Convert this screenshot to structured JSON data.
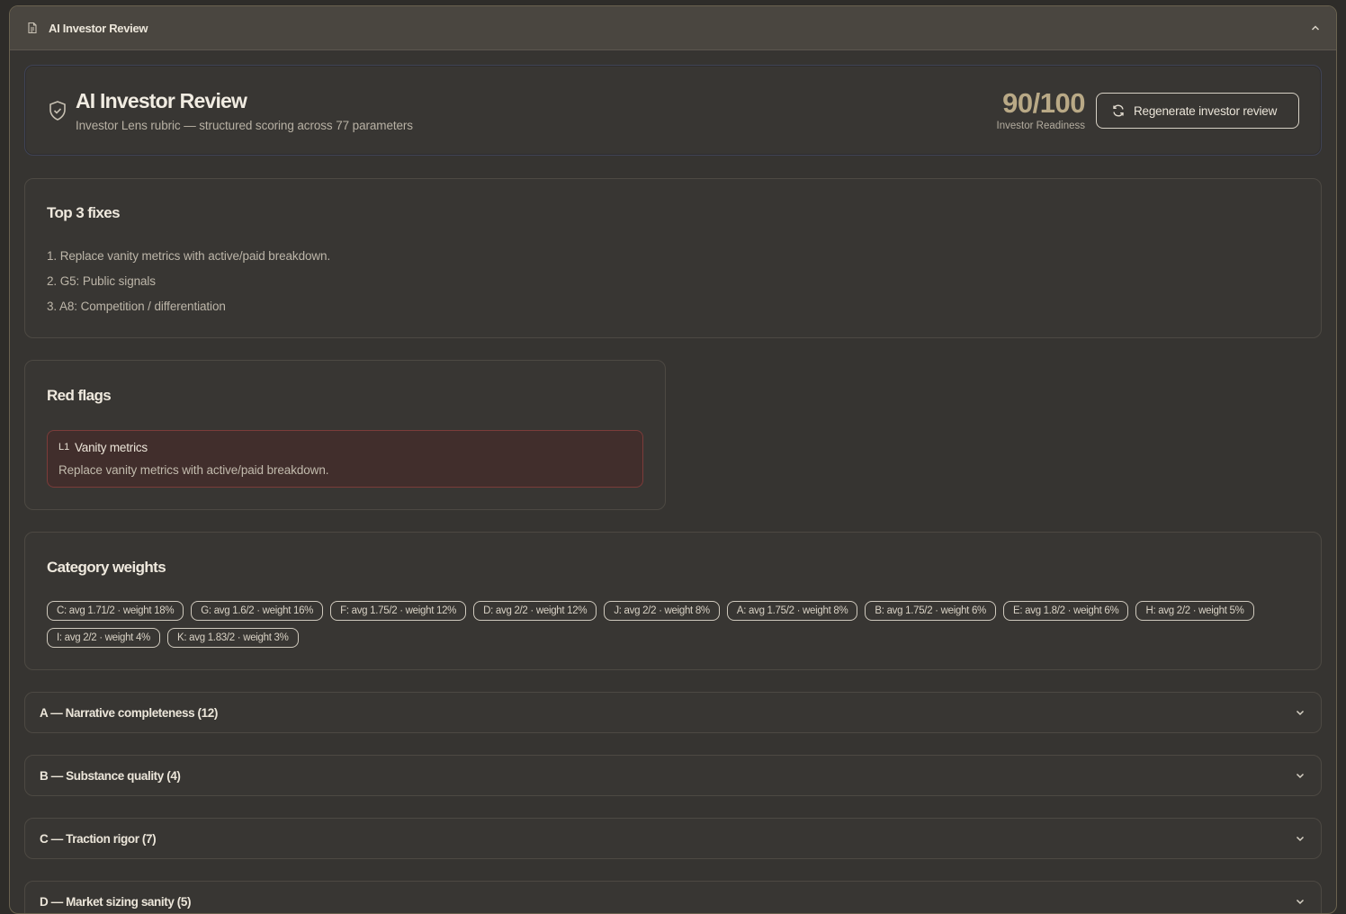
{
  "header": {
    "title": "AI Investor Review"
  },
  "hero": {
    "title": "AI Investor Review",
    "subtitle": "Investor Lens rubric — structured scoring across 77 parameters",
    "score": "90/100",
    "score_label": "Investor Readiness",
    "regenerate_label": "Regenerate investor review"
  },
  "fixes": {
    "title": "Top 3 fixes",
    "items": [
      "1. Replace vanity metrics with active/paid breakdown.",
      "2. G5: Public signals",
      "3. A8: Competition / differentiation"
    ]
  },
  "red_flags": {
    "title": "Red flags",
    "items": [
      {
        "id": "L1",
        "name": "Vanity metrics",
        "text": "Replace vanity metrics with active/paid breakdown."
      }
    ]
  },
  "weights": {
    "title": "Category weights",
    "chips": [
      "C: avg 1.71/2 · weight 18%",
      "G: avg 1.6/2 · weight 16%",
      "F: avg 1.75/2 · weight 12%",
      "D: avg 2/2 · weight 12%",
      "J: avg 2/2 · weight 8%",
      "A: avg 1.75/2 · weight 8%",
      "B: avg 1.75/2 · weight 6%",
      "E: avg 1.8/2 · weight 6%",
      "H: avg 2/2 · weight 5%",
      "I: avg 2/2 · weight 4%",
      "K: avg 1.83/2 · weight 3%"
    ]
  },
  "sections": [
    "A — Narrative completeness (12)",
    "B — Substance quality (4)",
    "C — Traction rigor (7)",
    "D — Market sizing sanity (5)"
  ],
  "colors": {
    "score": "#b9a986",
    "flag_bg": "#412e2c",
    "flag_border": "#7b3c3a",
    "panel_border": "#6a624f"
  }
}
